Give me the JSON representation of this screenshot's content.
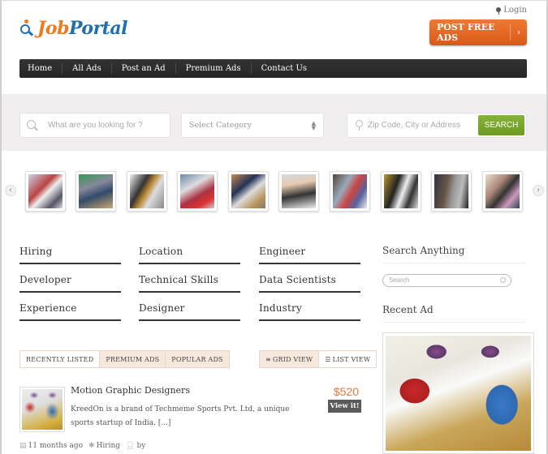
{
  "header": {
    "logo": {
      "part1": "Job",
      "part2": "Portal"
    },
    "login_label": "Login",
    "post_button_label": "POST FREE ADS",
    "post_button_arrow": "›",
    "brand_orange": "#f07a1f",
    "brand_blue": "#1f6fae"
  },
  "nav": {
    "items": [
      {
        "label": "Home"
      },
      {
        "label": "All Ads"
      },
      {
        "label": "Post an Ad"
      },
      {
        "label": "Premium Ads"
      },
      {
        "label": "Contact Us"
      }
    ]
  },
  "search": {
    "keyword_placeholder": "What are you looking for ?",
    "category_selected": "Select Category",
    "location_placeholder": "Zip Code, City or Address",
    "button_label": "SEARCH",
    "button_color": "#77a52c"
  },
  "carousel": {
    "prev_label": "‹",
    "next_label": "›",
    "thumbnails": [
      {
        "alt": "meeting-photo-1"
      },
      {
        "alt": "meeting-photo-2"
      },
      {
        "alt": "award-photo"
      },
      {
        "alt": "classroom-photo"
      },
      {
        "alt": "laptop-photo"
      },
      {
        "alt": "professional-woman-photo"
      },
      {
        "alt": "expo-booth-photo"
      },
      {
        "alt": "conversation-photo"
      },
      {
        "alt": "office-meeting-photo"
      },
      {
        "alt": "networking-photo"
      }
    ]
  },
  "categories": [
    "Hiring",
    "Location",
    "Engineer",
    "Developer",
    "Technical Skills",
    "Data Scientists",
    "Experience",
    "Designer",
    "Industry"
  ],
  "sidebar": {
    "search_heading": "Search Anything",
    "search_placeholder": "Search",
    "recent_heading": "Recent Ad"
  },
  "listing_tabs": {
    "tabs": [
      "RECENTLY LISTED",
      "PREMIUM ADS",
      "POPULAR ADS"
    ],
    "views": [
      "GRID VIEW",
      "LIST VIEW"
    ]
  },
  "listing": {
    "title": "Motion Graphic Designers",
    "description": "KreedOn is a brand of Techmeme Sports Pvt. Ltd, a unique sports startup of India. [...]",
    "price": "$520",
    "view_label": "View it!",
    "time": "11 months ago",
    "category": "Hiring",
    "author": "by"
  }
}
